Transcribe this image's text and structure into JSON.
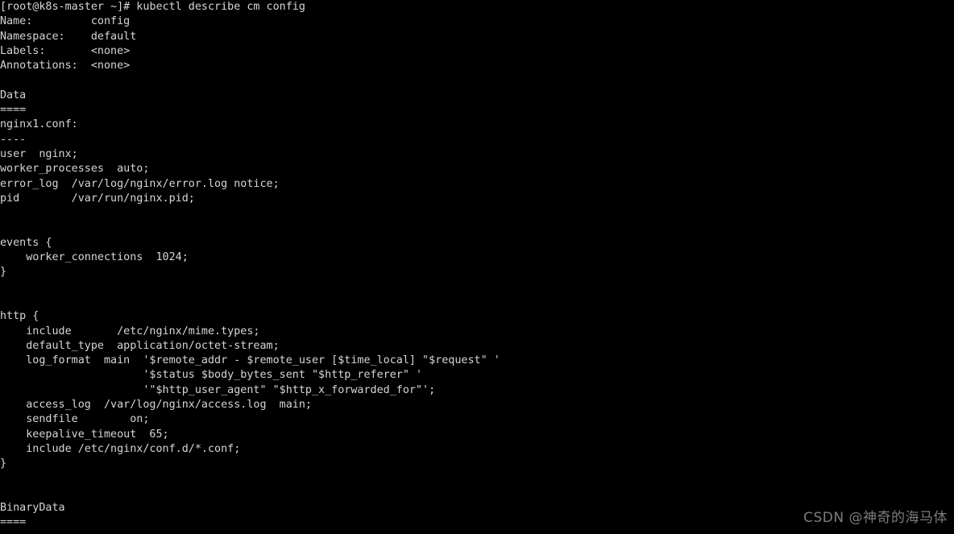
{
  "terminal": {
    "background_color": "#000000",
    "foreground_color": "#d6d6d6",
    "prompt": "[root@k8s-master ~]#",
    "command": "kubectl describe cm config",
    "lines": [
      "[root@k8s-master ~]# kubectl describe cm config",
      "Name:         config",
      "Namespace:    default",
      "Labels:       <none>",
      "Annotations:  <none>",
      "",
      "Data",
      "====",
      "nginx1.conf:",
      "----",
      "user  nginx;",
      "worker_processes  auto;",
      "error_log  /var/log/nginx/error.log notice;",
      "pid        /var/run/nginx.pid;",
      "",
      "",
      "events {",
      "    worker_connections  1024;",
      "}",
      "",
      "",
      "http {",
      "    include       /etc/nginx/mime.types;",
      "    default_type  application/octet-stream;",
      "    log_format  main  '$remote_addr - $remote_user [$time_local] \"$request\" '",
      "                      '$status $body_bytes_sent \"$http_referer\" '",
      "                      '\"$http_user_agent\" \"$http_x_forwarded_for\"';",
      "    access_log  /var/log/nginx/access.log  main;",
      "    sendfile        on;",
      "    keepalive_timeout  65;",
      "    include /etc/nginx/conf.d/*.conf;",
      "}",
      "",
      "",
      "BinaryData",
      "===="
    ],
    "fields": {
      "name_label": "Name:",
      "name_value": "config",
      "namespace_label": "Namespace:",
      "namespace_value": "default",
      "labels_label": "Labels:",
      "labels_value": "<none>",
      "annotations_label": "Annotations:",
      "annotations_value": "<none>",
      "data_section": "Data",
      "data_underline": "====",
      "data_key": "nginx1.conf:",
      "data_key_underline": "----",
      "binarydata_section": "BinaryData",
      "binarydata_underline": "===="
    }
  },
  "watermark": {
    "text": "CSDN @神奇的海马体",
    "color": "#7d7d7d"
  }
}
